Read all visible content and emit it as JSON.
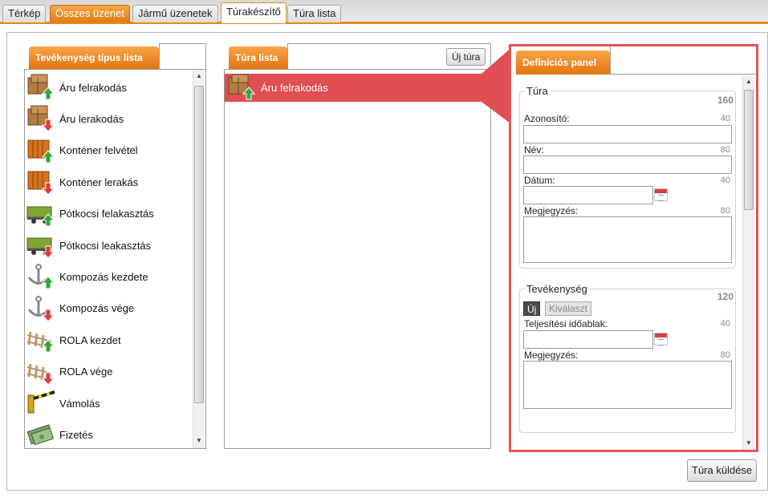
{
  "top_tabs": [
    {
      "label": "Térkép"
    },
    {
      "label": "Összes üzenet"
    },
    {
      "label": "Jármű üzenetek"
    },
    {
      "label": "Túrakészítő"
    },
    {
      "label": "Túra lista"
    }
  ],
  "activity_panel": {
    "title": "Tevékenység típus lista",
    "items": [
      {
        "label": "Áru felrakodás",
        "icon": "box-load-icon"
      },
      {
        "label": "Áru lerakodás",
        "icon": "box-unload-icon"
      },
      {
        "label": "Konténer felvétel",
        "icon": "container-pickup-icon"
      },
      {
        "label": "Konténer lerakás",
        "icon": "container-drop-icon"
      },
      {
        "label": "Pótkocsi felakasztás",
        "icon": "trailer-hitch-icon"
      },
      {
        "label": "Pótkocsi leakasztás",
        "icon": "trailer-unhitch-icon"
      },
      {
        "label": "Kompozás kezdete",
        "icon": "ferry-start-icon"
      },
      {
        "label": "Kompozás vége",
        "icon": "ferry-end-icon"
      },
      {
        "label": "ROLA kezdet",
        "icon": "rola-start-icon"
      },
      {
        "label": "ROLA vége",
        "icon": "rola-end-icon"
      },
      {
        "label": "Vámolás",
        "icon": "customs-barrier-icon"
      },
      {
        "label": "Fizetés",
        "icon": "payment-icon"
      }
    ]
  },
  "tour_panel": {
    "title": "Túra lista",
    "new_button": "Új túra",
    "items": [
      {
        "label": "Áru felrakodás",
        "icon": "box-load-icon"
      }
    ]
  },
  "definition_panel": {
    "title": "Definíciós panel",
    "tura": {
      "legend": "Túra",
      "count": "160",
      "fields": [
        {
          "label": "Azonosító:",
          "max": "40",
          "value": ""
        },
        {
          "label": "Név:",
          "max": "80",
          "value": ""
        },
        {
          "label": "Dátum:",
          "max": "40",
          "value": ""
        },
        {
          "label": "Megjegyzés:",
          "max": "80",
          "value": ""
        }
      ]
    },
    "tevekenyseg": {
      "legend": "Tevékenység",
      "count": "120",
      "new_button": "Új",
      "select_button": "Kiválaszt",
      "fields": [
        {
          "label": "Teljesítési időablak:",
          "max": "40",
          "value": ""
        },
        {
          "label": "Megjegyzés:",
          "max": "80",
          "value": ""
        }
      ]
    }
  },
  "send_button": "Túra küldése",
  "colors": {
    "accent_orange": "#e27b12",
    "selection_red": "#e04e52"
  }
}
